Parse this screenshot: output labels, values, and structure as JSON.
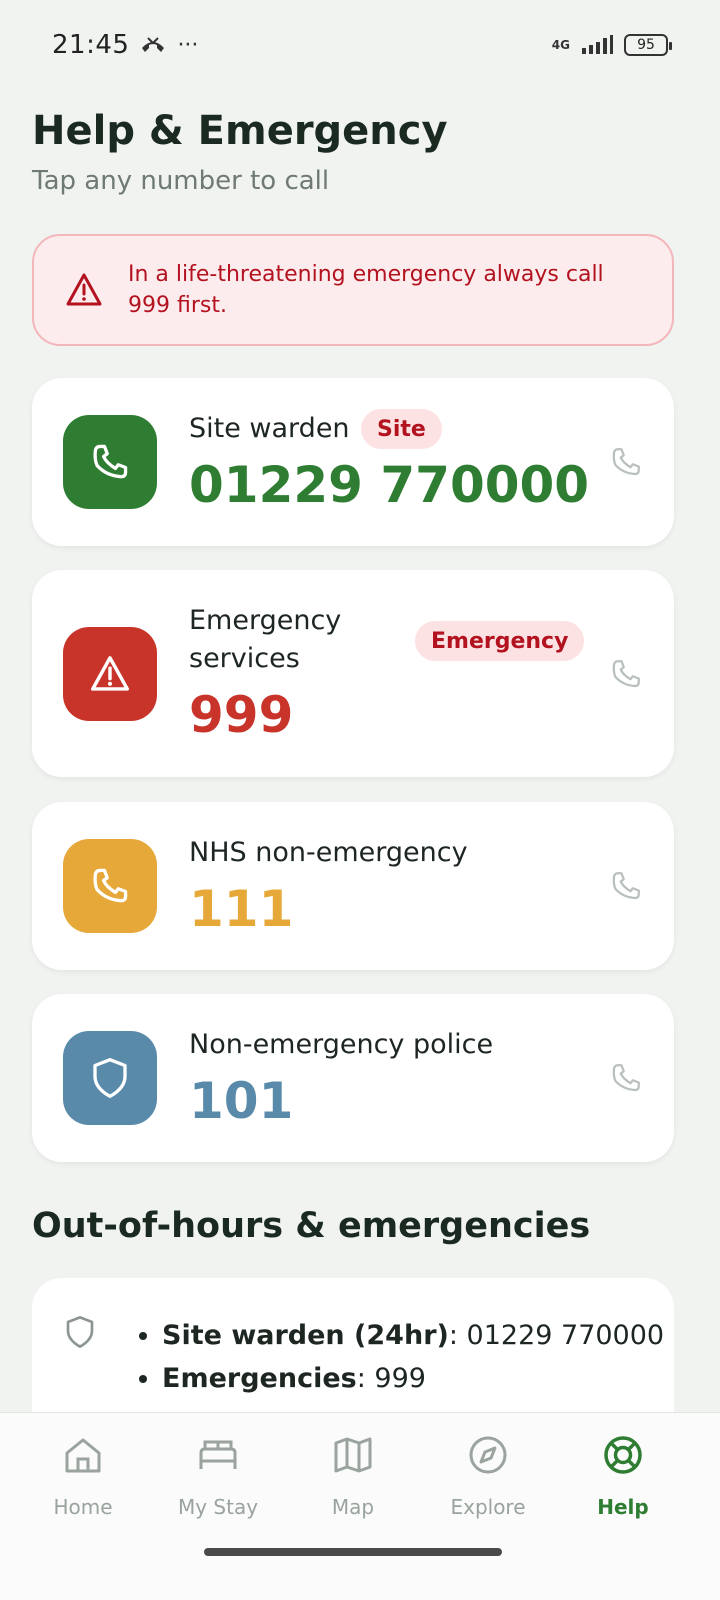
{
  "status": {
    "time": "21:45",
    "network": "4G",
    "battery": "95"
  },
  "header": {
    "title": "Help & Emergency",
    "subtitle": "Tap any number to call"
  },
  "alert": {
    "text": "In a life-threatening emergency always call 999 first."
  },
  "contacts": [
    {
      "name": "Site warden",
      "number": "01229 770000",
      "badge": "Site",
      "color": "#2e7d32",
      "icon": "phone-icon"
    },
    {
      "name": "Emergency services",
      "number": "999",
      "badge": "Emergency",
      "color": "#c9342a",
      "icon": "warning-icon"
    },
    {
      "name": "NHS non-emergency",
      "number": "111",
      "badge": "",
      "color": "#e6a838",
      "icon": "phone-icon"
    },
    {
      "name": "Non-emergency police",
      "number": "101",
      "badge": "",
      "color": "#5a8aaa",
      "icon": "shield-icon"
    }
  ],
  "section": {
    "title": "Out-of-hours & emergencies",
    "items": [
      {
        "label": "Site warden (24hr)",
        "value": "01229 770000"
      },
      {
        "label": "Emergencies",
        "value": "999"
      }
    ]
  },
  "nav": [
    {
      "label": "Home",
      "icon": "home-icon",
      "active": false
    },
    {
      "label": "My Stay",
      "icon": "bed-icon",
      "active": false
    },
    {
      "label": "Map",
      "icon": "map-icon",
      "active": false
    },
    {
      "label": "Explore",
      "icon": "compass-icon",
      "active": false
    },
    {
      "label": "Help",
      "icon": "lifebuoy-icon",
      "active": true
    }
  ]
}
